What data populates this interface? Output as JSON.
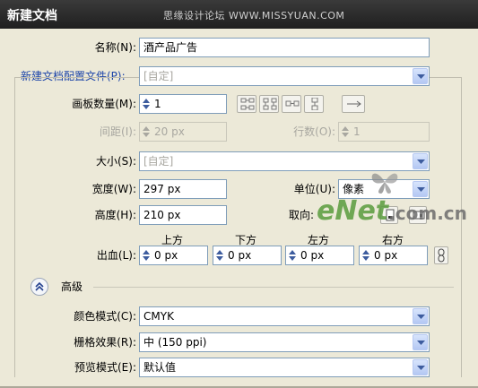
{
  "window": {
    "title": "新建文档",
    "watermark": "思缘设计论坛 WWW.MISSYUAN.COM"
  },
  "name": {
    "label": "名称(N):",
    "value": "酒产品广告"
  },
  "profile": {
    "label": "新建文档配置文件(P):",
    "value": "[自定]"
  },
  "artboards": {
    "label": "画板数量(M):",
    "value": "1"
  },
  "spacing": {
    "label": "间距(I):",
    "value": "20 px"
  },
  "columns": {
    "label": "行数(O):",
    "value": "1"
  },
  "size": {
    "label": "大小(S):",
    "value": "[自定]"
  },
  "width": {
    "label": "宽度(W):",
    "value": "297 px"
  },
  "units": {
    "label": "单位(U):",
    "value": "像素"
  },
  "height": {
    "label": "高度(H):",
    "value": "210 px"
  },
  "orientation": {
    "label": "取向:"
  },
  "bleed": {
    "label": "出血(L):",
    "headers": [
      "上方",
      "下方",
      "左方",
      "右方"
    ],
    "values": [
      "0 px",
      "0 px",
      "0 px",
      "0 px"
    ]
  },
  "advanced": {
    "label": "高级"
  },
  "color_mode": {
    "label": "颜色模式(C):",
    "value": "CMYK"
  },
  "raster": {
    "label": "栅格效果(R):",
    "value": "中 (150 ppi)"
  },
  "preview": {
    "label": "预览模式(E):",
    "value": "默认值"
  },
  "site_watermark": {
    "e": "eNet",
    "c": ".com.cn"
  },
  "icons": {
    "arrange_icons": [
      "grid-by-row-icon",
      "grid-by-column-icon",
      "arrange-by-row-icon",
      "arrange-by-column-icon",
      "right-to-left-icon"
    ],
    "link_icon": "chain-link-icon",
    "orientation_icons": [
      "portrait-icon",
      "landscape-icon"
    ]
  }
}
